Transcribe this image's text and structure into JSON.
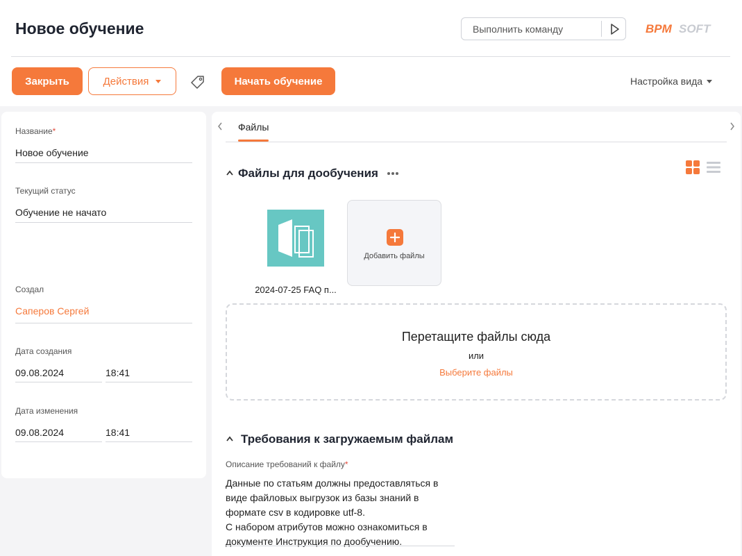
{
  "header": {
    "title": "Новое обучение",
    "command_placeholder": "Выполнить команду",
    "logo_left": "BPM",
    "logo_right": "SOFT"
  },
  "toolbar": {
    "close_label": "Закрыть",
    "actions_label": "Действия",
    "start_label": "Начать обучение",
    "view_settings_label": "Настройка вида"
  },
  "left_panel": {
    "name_label": "Название",
    "name_value": "Новое обучение",
    "status_label": "Текущий статус",
    "status_value": "Обучение не начато",
    "created_by_label": "Создал",
    "created_by_value": "Саперов Сергей",
    "created_date_label": "Дата создания",
    "created_date": "09.08.2024",
    "created_time": "18:41",
    "modified_date_label": "Дата изменения",
    "modified_date": "09.08.2024",
    "modified_time": "18:41"
  },
  "tabs": [
    {
      "label": "Файлы"
    }
  ],
  "files_section": {
    "title": "Файлы для дообучения",
    "files": [
      {
        "name": "2024-07-25 FAQ п..."
      }
    ],
    "add_label": "Добавить файлы",
    "dropzone_title": "Перетащите файлы сюда",
    "dropzone_or": "или",
    "dropzone_link": "Выберите файлы"
  },
  "requirements_section": {
    "title": "Требования к загружаемым файлам",
    "field_label": "Описание требований к файлу",
    "field_lines": [
      "Данные по статьям должны предоставляться в",
      "виде файловых выгрузок из базы знаний в",
      "формате csv в кодировке utf-8.",
      "С набором атрибутов можно ознакомиться в",
      "документе Инструкция по дообучению."
    ]
  },
  "colors": {
    "accent": "#f5793b",
    "file_tile": "#67c7c3",
    "required_mark": "#e24b3c"
  },
  "icons": [
    "run-command-icon",
    "tag-icon",
    "chevron-left-icon",
    "chevron-right-icon",
    "chevron-up-icon",
    "more-icon",
    "grid-view-icon",
    "list-view-icon",
    "document-icon",
    "plus-icon"
  ]
}
